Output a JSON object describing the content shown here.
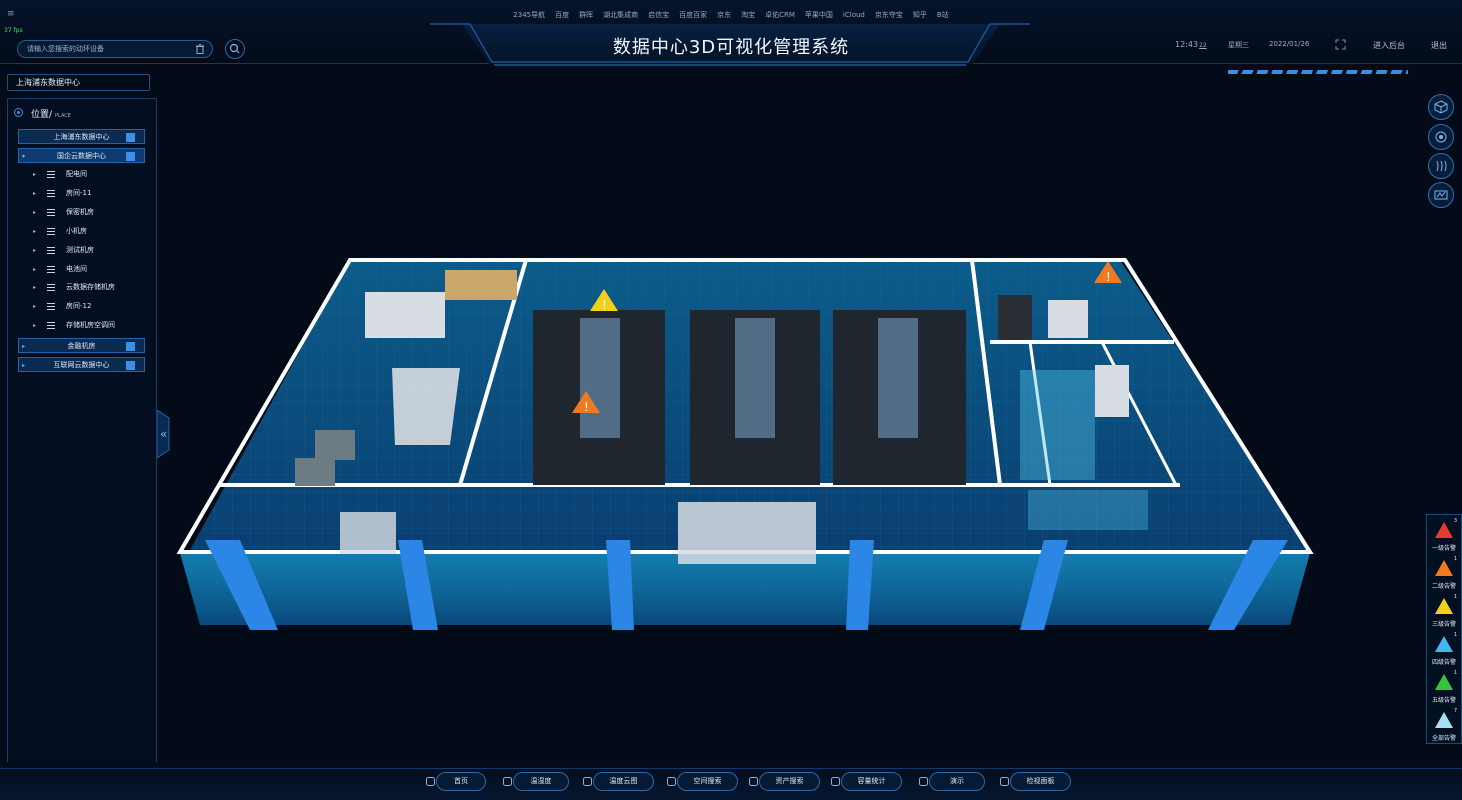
{
  "header": {
    "links": [
      "2345导航",
      "百度",
      "群晖",
      "湖北集成商",
      "启信宝",
      "百度百家",
      "京东",
      "淘宝",
      "卓佑CRM",
      "苹果中国",
      "iCloud",
      "京东夺宝",
      "知乎",
      "B站"
    ],
    "fps": "37 fps",
    "title": "数据中心3D可视化管理系统",
    "search_placeholder": "请输入您搜索的动环设备",
    "time": "12:43",
    "time_sec": "22",
    "weekday": "星期三",
    "date": "2022/01/26",
    "admin_label": "进入后台",
    "logout_label": "退出"
  },
  "sidebar": {
    "header": "上海浦东数据中心",
    "place_label": "位置/",
    "place_sub": "PLACE",
    "folders": [
      {
        "label": "上海浦东数据中心",
        "selected": false,
        "expanded": false
      },
      {
        "label": "国企云数据中心",
        "selected": true,
        "expanded": true
      }
    ],
    "children": [
      "配电间",
      "房间-11",
      "保密机房",
      "小机房",
      "测试机房",
      "电池间",
      "云数据存储机房",
      "房间-12",
      "存储机房空调间"
    ],
    "folders_after": [
      {
        "label": "金融机房"
      },
      {
        "label": "互联网云数据中心"
      }
    ]
  },
  "scene": {
    "alert_markers": [
      {
        "level": "三级告警",
        "color": "#f2cf1d"
      },
      {
        "level": "二级告警",
        "color": "#f07a22"
      },
      {
        "level": "二级告警",
        "color": "#f07a22"
      }
    ]
  },
  "alerts": [
    {
      "label": "一级告警",
      "count": "3",
      "color": "#e53a2f"
    },
    {
      "label": "二级告警",
      "count": "1",
      "color": "#f07a22"
    },
    {
      "label": "三级告警",
      "count": "1",
      "color": "#f2cf1d"
    },
    {
      "label": "四级告警",
      "count": "1",
      "color": "#3fb8f0"
    },
    {
      "label": "五级告警",
      "count": "1",
      "color": "#37c43d"
    },
    {
      "label": "全部告警",
      "count": "7",
      "color": "#a6def5"
    }
  ],
  "side_tools": [
    "cube-view-icon",
    "rotate-view-icon",
    "heat-wave-icon",
    "topology-icon"
  ],
  "bottom_nav": [
    {
      "label": "首页",
      "icon": "home-icon"
    },
    {
      "label": "温湿度",
      "icon": "thermometer-icon"
    },
    {
      "label": "温度云图",
      "icon": "cloud-icon"
    },
    {
      "label": "空间搜索",
      "icon": "space-search-icon"
    },
    {
      "label": "资产搜索",
      "icon": "asset-search-icon"
    },
    {
      "label": "容量统计",
      "icon": "pie-chart-icon"
    },
    {
      "label": "演示",
      "icon": "presentation-icon"
    },
    {
      "label": "检视面板",
      "icon": "dashboard-icon"
    }
  ],
  "colors": {
    "background": "#030b18",
    "accent": "#3a8fe0",
    "wall": "#1b8fd0",
    "floor": "#0a4f7d"
  }
}
